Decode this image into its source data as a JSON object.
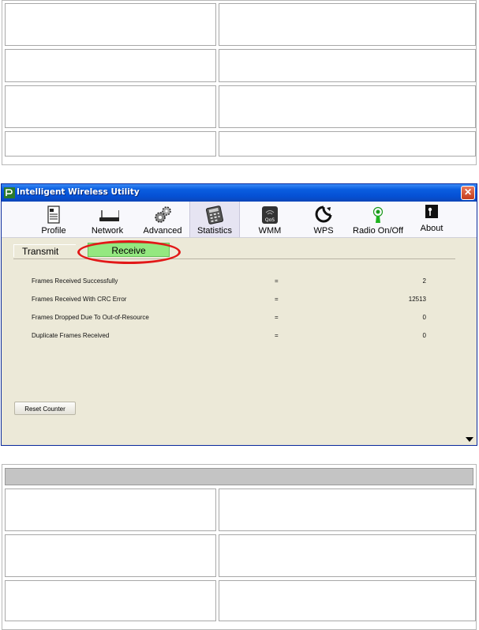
{
  "window": {
    "title": "Intelligent Wireless Utility",
    "close_glyph": "✕"
  },
  "toolbar": {
    "items": [
      {
        "label": "Profile",
        "icon": "profile-icon"
      },
      {
        "label": "Network",
        "icon": "network-icon"
      },
      {
        "label": "Advanced",
        "icon": "advanced-gears-icon"
      },
      {
        "label": "Statistics",
        "icon": "statistics-calculator-icon",
        "selected": true
      },
      {
        "label": "WMM",
        "icon": "wmm-qos-icon"
      },
      {
        "label": "WPS",
        "icon": "wps-icon"
      },
      {
        "label": "Radio On/Off",
        "icon": "radio-antenna-icon"
      },
      {
        "label": "About",
        "icon": "about-icon"
      }
    ]
  },
  "tabs": {
    "transmit": "Transmit",
    "receive": "Receive",
    "active": "Receive"
  },
  "stats": [
    {
      "label": "Frames Received Successfully",
      "eq": "=",
      "value": "2"
    },
    {
      "label": "Frames Received With CRC Error",
      "eq": "=",
      "value": "12513"
    },
    {
      "label": "Frames Dropped Due To Out-of-Resource",
      "eq": "=",
      "value": "0"
    },
    {
      "label": "Duplicate Frames Received",
      "eq": "=",
      "value": "0"
    }
  ],
  "reset_button": "Reset Counter",
  "colors": {
    "titlebar": "#0550d4",
    "receive_tab": "#94e880",
    "highlight": "#e21818",
    "window_bg": "#ece9d8"
  }
}
